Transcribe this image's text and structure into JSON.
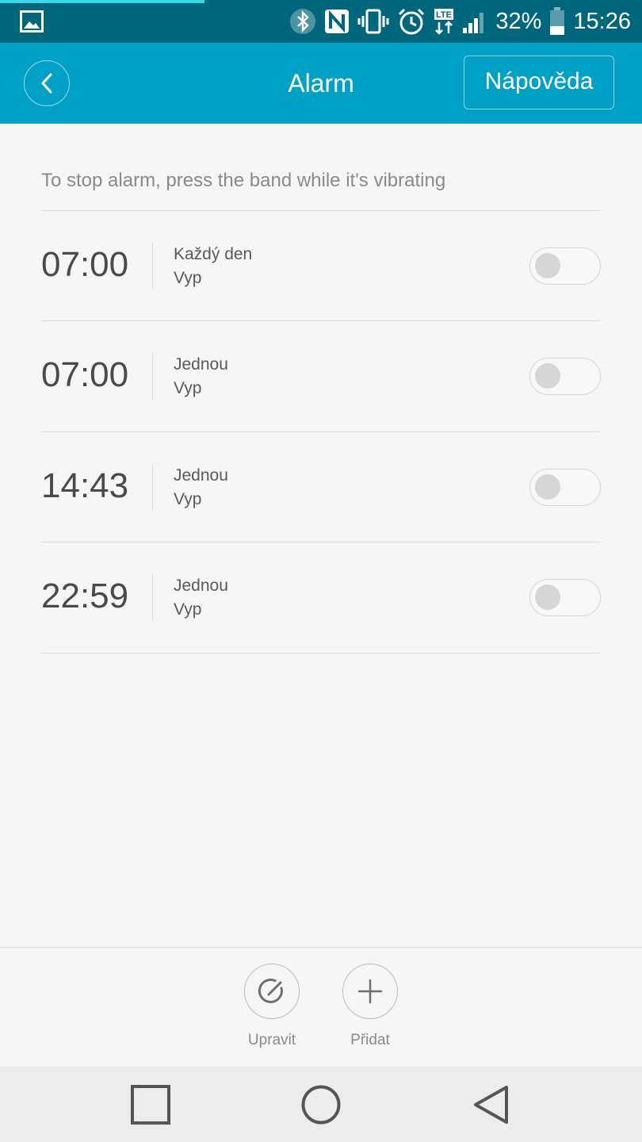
{
  "status_bar": {
    "battery": "32%",
    "time": "15:26",
    "network": "LTE",
    "icons": [
      "image-icon",
      "bluetooth-icon",
      "nfc-icon",
      "vibrate-icon",
      "alarm-clock-icon",
      "lte-icon",
      "signal-icon",
      "battery-icon"
    ]
  },
  "app_bar": {
    "title": "Alarm",
    "help_label": "Nápověda",
    "back_icon": "chevron-left-icon"
  },
  "hint": "To stop alarm, press the band while it's vibrating",
  "alarms": [
    {
      "time": "07:00",
      "repeat": "Každý den",
      "state": "Vyp",
      "enabled": false
    },
    {
      "time": "07:00",
      "repeat": "Jednou",
      "state": "Vyp",
      "enabled": false
    },
    {
      "time": "14:43",
      "repeat": "Jednou",
      "state": "Vyp",
      "enabled": false
    },
    {
      "time": "22:59",
      "repeat": "Jednou",
      "state": "Vyp",
      "enabled": false
    }
  ],
  "actions": {
    "edit_label": "Upravit",
    "add_label": "Přidat"
  },
  "navigation": {
    "buttons": [
      "recent-apps-icon",
      "home-icon",
      "back-icon"
    ]
  },
  "colors": {
    "status_bar": "#00667c",
    "app_bar": "#00a1c4",
    "background": "#f6f6f6",
    "nav_bar": "#ececec"
  }
}
